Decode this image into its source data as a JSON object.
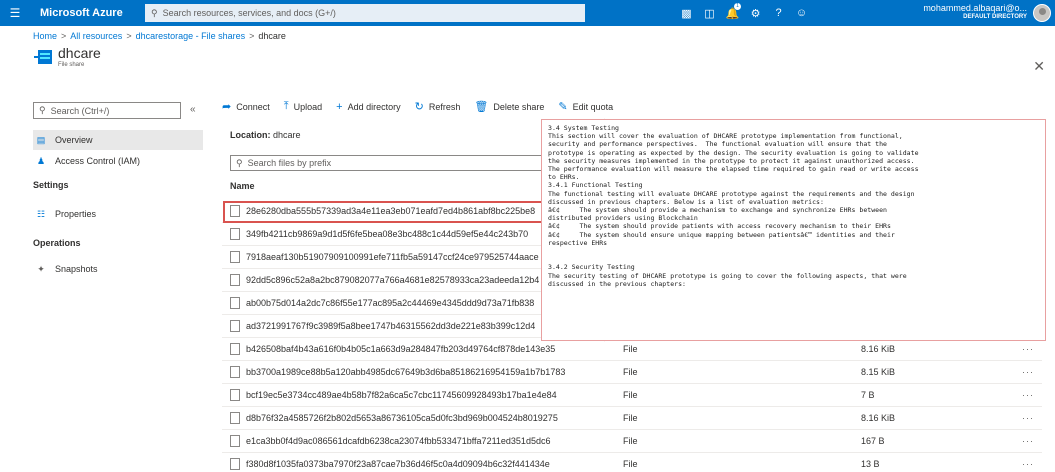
{
  "topbar": {
    "brand": "Microsoft Azure",
    "search_placeholder": "Search resources, services, and docs (G+/)",
    "notification_count": "1",
    "user_name": "mohammed.albaqari@o...",
    "user_directory": "DEFAULT DIRECTORY"
  },
  "breadcrumb": [
    {
      "label": "Home"
    },
    {
      "label": "All resources"
    },
    {
      "label": "dhcarestorage - File shares"
    },
    {
      "label": "dhcare"
    }
  ],
  "resource": {
    "title": "dhcare",
    "subtitle": "File share"
  },
  "nav": {
    "search_placeholder": "Search (Ctrl+/)",
    "overview": "Overview",
    "access_control": "Access Control (IAM)",
    "settings_header": "Settings",
    "properties": "Properties",
    "operations_header": "Operations",
    "snapshots": "Snapshots"
  },
  "toolbar": {
    "connect": "Connect",
    "upload": "Upload",
    "add_directory": "Add directory",
    "refresh": "Refresh",
    "delete_share": "Delete share",
    "edit_quota": "Edit quota"
  },
  "location_label": "Location:",
  "location_value": "dhcare",
  "file_search_placeholder": "Search files by prefix",
  "column_name": "Name",
  "rows": [
    {
      "name": "28e6280dba555b57339ad3a4e11ea3eb071eafd7ed4b861abf8bc225be8",
      "type": "",
      "size": ""
    },
    {
      "name": "349fb4211cb9869a9d1d5f6fe5bea08e3bc488c1c44d59ef5e44c243b70",
      "type": "",
      "size": ""
    },
    {
      "name": "7918aeaf130b51907909100991efe711fb5a59147ccf24ce979525744aace",
      "type": "",
      "size": ""
    },
    {
      "name": "92dd5c896c52a8a2bc879082077a766a4681e82578933ca23adeeda12b4",
      "type": "",
      "size": ""
    },
    {
      "name": "ab00b75d014a2dc7c86f55e177ac895a2c44469e4345ddd9d73a71fb838",
      "type": "",
      "size": ""
    },
    {
      "name": "ad3721991767f9c3989f5a8bee1747b46315562dd3de221e83b399c12d4",
      "type": "",
      "size": ""
    },
    {
      "name": "b426508baf4b43a616f0b4b05c1a663d9a284847fb203d49764cf878de143e35",
      "type": "File",
      "size": "8.16 KiB"
    },
    {
      "name": "bb3700a1989ce88b5a120abb4985dc67649b3d6ba85186216954159a1b7b1783",
      "type": "File",
      "size": "8.15 KiB"
    },
    {
      "name": "bcf19ec5e3734cc489ae4b58b7f82a6ca5c7cbc11745609928493b17ba1e4e84",
      "type": "File",
      "size": "7 B"
    },
    {
      "name": "d8b76f32a4585726f2b802d5653a86736105ca5d0fc3bd969b004524b8019275",
      "type": "File",
      "size": "8.16 KiB"
    },
    {
      "name": "e1ca3bb0f4d9ac086561dcafdb6238ca23074fbb533471bffa7211ed351d5dc6",
      "type": "File",
      "size": "167 B"
    },
    {
      "name": "f380d8f1035fa0373ba7970f23a87cae7b36d46f5c0a4d09094b6c32f441434e",
      "type": "File",
      "size": "13 B"
    }
  ],
  "overlay_text": "3.4 System Testing\nThis section will cover the evaluation of DHCARE prototype implementation from functional,\nsecurity and performance perspectives.  The functional evaluation will ensure that the\nprototype is operating as expected by the design. The security evaluation is going to validate\nthe security measures implemented in the prototype to protect it against unauthorized access.\nThe performance evaluation will measure the elapsed time required to gain read or write access\nto EHRs.\n3.4.1 Functional Testing\nThe functional testing will evaluate DHCARE prototype against the requirements and the design\ndiscussed in previous chapters. Below is a list of evaluation metrics:\nâ€¢     The system should provide a mechanism to exchange and synchronize EHRs between\ndistributed providers using Blockchain\nâ€¢     The system should provide patients with access recovery mechanism to their EHRs\nâ€¢     The system should ensure unique mapping between patientsâ€™ identities and their\nrespective EHRs\n\n\n3.4.2 Security Testing\nThe security testing of DHCARE prototype is going to cover the following aspects, that were\ndiscussed in the previous chapters:"
}
